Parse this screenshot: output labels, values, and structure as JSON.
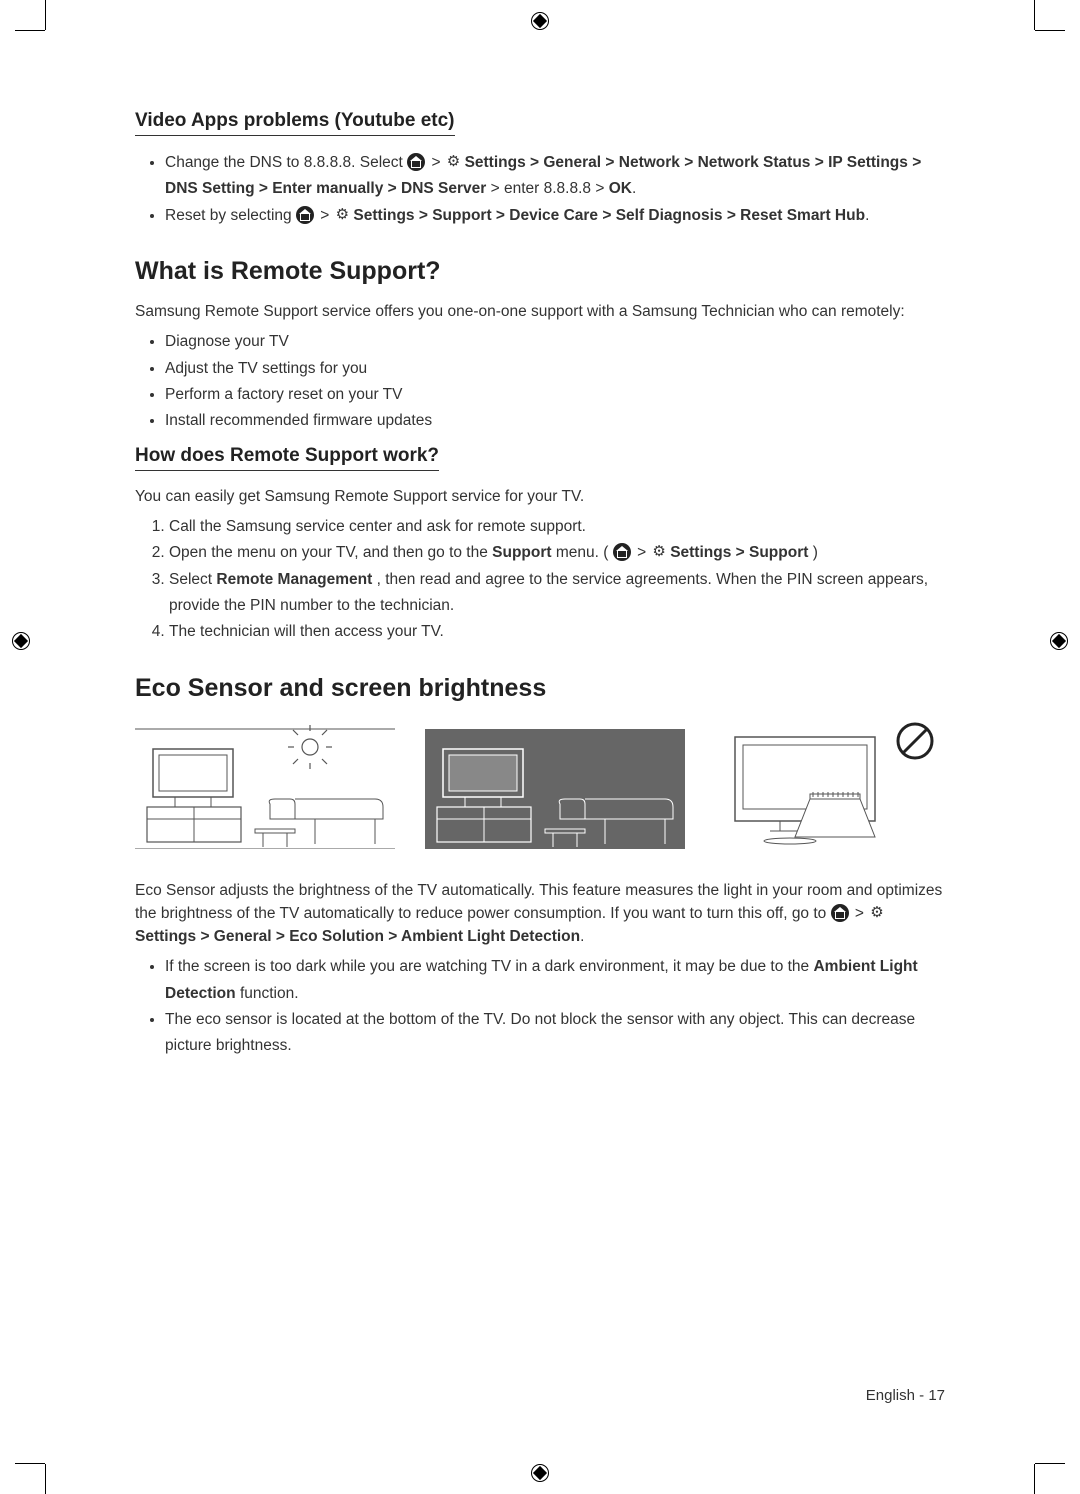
{
  "sec1": {
    "heading": "Video Apps problems (Youtube etc)",
    "bullet1a": "Change the DNS to 8.8.8.8. Select ",
    "bullet1_path": "Settings > General > Network > Network Status > IP Settings > DNS Setting > Enter manually > DNS Server",
    "bullet1b": " > enter 8.8.8.8 > ",
    "bullet1_ok": "OK",
    "bullet2a": "Reset by selecting ",
    "bullet2_path": "Settings > Support > Device Care > Self Diagnosis > Reset Smart Hub"
  },
  "sec2": {
    "heading": "What is Remote Support?",
    "intro": "Samsung Remote Support service offers you one-on-one support with a Samsung Technician who can remotely:",
    "b1": "Diagnose your TV",
    "b2": "Adjust the TV settings for you",
    "b3": "Perform a factory reset on your TV",
    "b4": "Install recommended firmware updates"
  },
  "sec3": {
    "heading": "How does Remote Support work?",
    "intro": "You can easily get Samsung Remote Support service for your TV.",
    "o1": "Call the Samsung service center and ask for remote support.",
    "o2a": "Open the menu on your TV, and then go to the ",
    "o2_support": "Support",
    "o2b": " menu. (",
    "o2_path": "Settings > Support",
    "o2c": ")",
    "o3a": "Select ",
    "o3_bold": "Remote Management",
    "o3b": ", then read and agree to the service agreements. When the PIN screen appears, provide the PIN number to the technician.",
    "o4": "The technician will then access your TV."
  },
  "sec4": {
    "heading": "Eco Sensor and screen brightness",
    "p1a": "Eco Sensor adjusts the brightness of the TV automatically. This feature measures the light in your room and optimizes the brightness of the TV automatically to reduce power consumption. If you want to turn this off, go to ",
    "p1_path": "Settings > General > Eco Solution > Ambient Light Detection",
    "b1a": "If the screen is too dark while you are watching TV in a dark environment, it may be due to the ",
    "b1_bold": "Ambient Light Detection",
    "b1b": " function.",
    "b2": "The eco sensor is located at the bottom of the TV. Do not block the sensor with any object. This can decrease picture brightness."
  },
  "footer": {
    "lang": "English",
    "page": "17"
  }
}
